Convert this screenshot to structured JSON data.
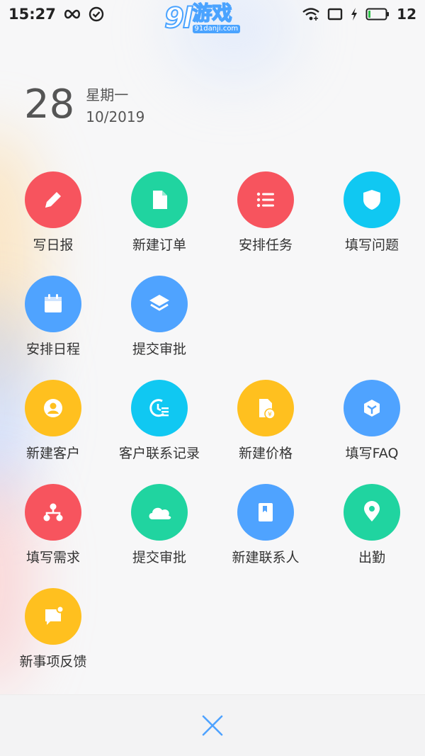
{
  "status_bar": {
    "time": "15:27",
    "battery": "12",
    "icons": [
      "infinity-icon",
      "check-circle-icon",
      "wifi-icon",
      "screen-icon",
      "charging-icon",
      "battery-icon"
    ]
  },
  "watermark": {
    "number": "9l",
    "text": "游戏",
    "url": "91danji.com"
  },
  "date": {
    "day": "28",
    "weekday": "星期一",
    "month_year": "10/2019"
  },
  "actions": [
    {
      "label": "写日报",
      "icon": "pencil-icon",
      "color": "#F7545E"
    },
    {
      "label": "新建订单",
      "icon": "document-icon",
      "color": "#20D4A0"
    },
    {
      "label": "安排任务",
      "icon": "list-icon",
      "color": "#F7545E"
    },
    {
      "label": "填写问题",
      "icon": "shield-icon",
      "color": "#10C8F2"
    },
    {
      "label": "安排日程",
      "icon": "calendar-icon",
      "color": "#4FA3FF"
    },
    {
      "label": "提交审批",
      "icon": "layers-icon",
      "color": "#4FA3FF"
    },
    {
      "label": "新建客户",
      "icon": "user-icon",
      "color": "#FFC01F"
    },
    {
      "label": "客户联系记录",
      "icon": "clock-list-icon",
      "color": "#10C8F2"
    },
    {
      "label": "新建价格",
      "icon": "price-doc-icon",
      "color": "#FFC01F"
    },
    {
      "label": "填写FAQ",
      "icon": "cube-icon",
      "color": "#4FA3FF"
    },
    {
      "label": "填写需求",
      "icon": "org-chart-icon",
      "color": "#F7545E"
    },
    {
      "label": "提交审批",
      "icon": "cloud-icon",
      "color": "#20D4A0"
    },
    {
      "label": "新建联系人",
      "icon": "contact-book-icon",
      "color": "#4FA3FF"
    },
    {
      "label": "出勤",
      "icon": "location-pin-icon",
      "color": "#20D4A0"
    },
    {
      "label": "新事项反馈",
      "icon": "message-icon",
      "color": "#FFC01F"
    }
  ],
  "bottom": {
    "close_icon": "close-icon",
    "close_color": "#4FA3FF"
  }
}
